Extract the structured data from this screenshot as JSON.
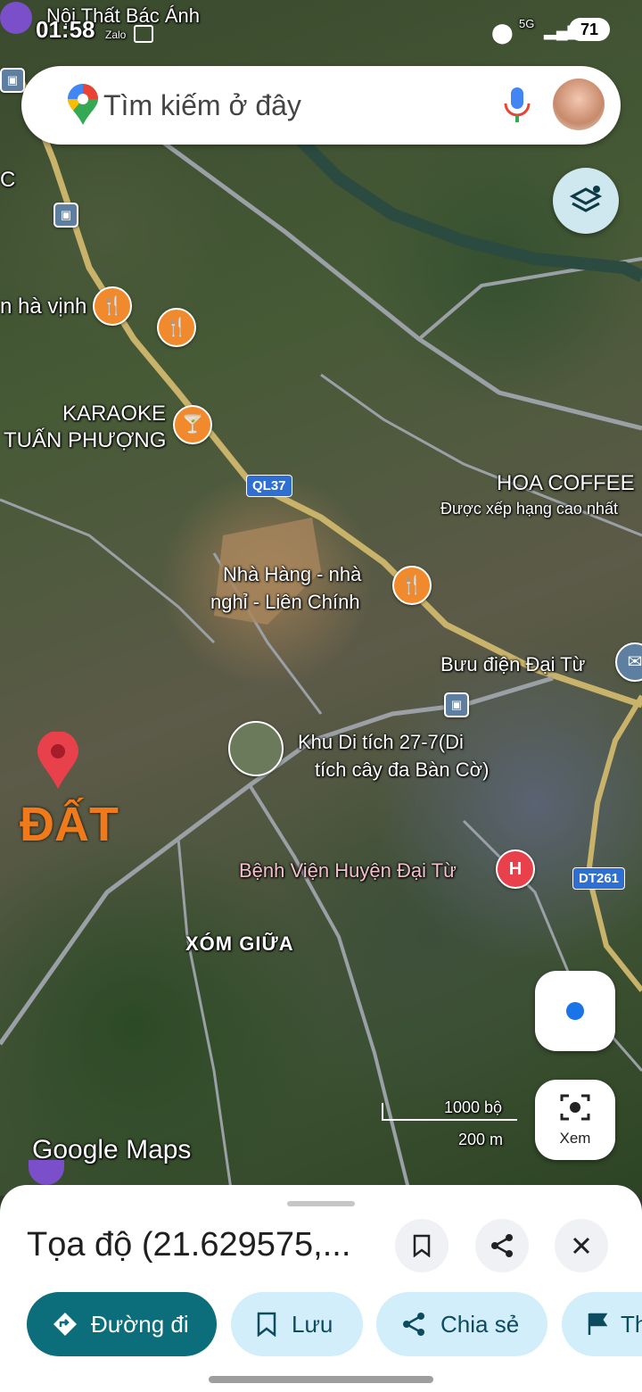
{
  "status_bar": {
    "time": "01:58",
    "top_label": "Nội Thất Bác Ánh",
    "app_icon": "Zalo",
    "network": "5G",
    "battery": "71"
  },
  "search": {
    "placeholder": "Tìm kiếm ở đây",
    "icons": [
      "google-maps-pin-icon",
      "mic-icon",
      "avatar"
    ]
  },
  "map": {
    "labels": {
      "ha_vinh": "n hà vịnh",
      "karaoke_1": "KARAOKE",
      "karaoke_2": "TUẤN PHƯỢNG",
      "route_ql37": "QL37",
      "hoa_coffee": "HOA COFFEE",
      "hoa_coffee_sub": "Được xếp hạng cao nhất",
      "nha_hang_1": "Nhà Hàng - nhà",
      "nha_hang_2": "nghỉ - Liên Chính",
      "buu_dien": "Bưu điện Đại Từ",
      "khu_di_tich_1": "Khu Di tích 27-7(Di",
      "khu_di_tich_2": "tích cây đa Bàn Cờ)",
      "dat": "ĐẤT",
      "benh_vien": "Bệnh Viện Huyện Đại Từ",
      "route_dt261": "DT261",
      "xom_giua": "XÓM GIỮA",
      "left_c": "C",
      "google_maps": "Google Maps"
    },
    "scale": {
      "top": "1000 bộ",
      "bottom": "200 m"
    },
    "lens_label": "Xem"
  },
  "sheet": {
    "title": "Tọa độ (21.629575,...",
    "chips": {
      "directions": "Đường đi",
      "save": "Lưu",
      "share": "Chia sẻ",
      "more": "Th"
    }
  },
  "colors": {
    "teal": "#0c6e7a",
    "chip_bg": "#d2eefa",
    "poi_orange": "#f08a2c",
    "pin_red": "#e8414c"
  }
}
